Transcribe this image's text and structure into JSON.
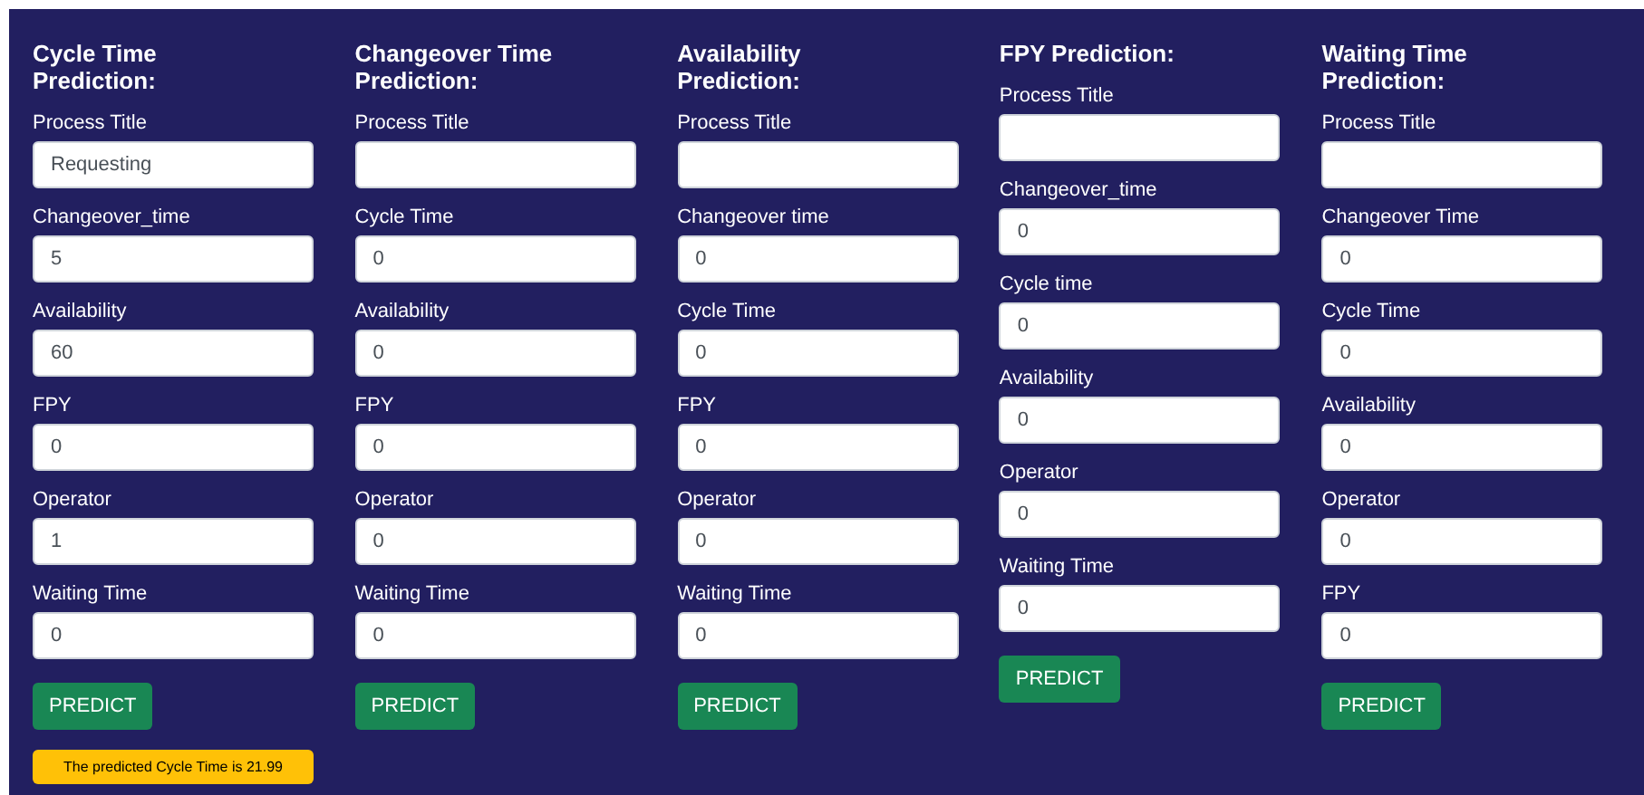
{
  "forms": [
    {
      "title": "Cycle Time Prediction:",
      "fields": [
        {
          "label": "Process Title",
          "value": "Requesting"
        },
        {
          "label": "Changeover_time",
          "value": "5"
        },
        {
          "label": "Availability",
          "value": "60"
        },
        {
          "label": "FPY",
          "value": "0"
        },
        {
          "label": "Operator",
          "value": "1"
        },
        {
          "label": "Waiting Time",
          "value": "0"
        }
      ],
      "button": "PREDICT",
      "result": "The predicted Cycle Time is 21.99"
    },
    {
      "title": "Changeover Time Prediction:",
      "fields": [
        {
          "label": "Process Title"
        },
        {
          "label": "Cycle Time",
          "value": "0"
        },
        {
          "label": "Availability",
          "value": "0"
        },
        {
          "label": "FPY",
          "value": "0"
        },
        {
          "label": "Operator",
          "value": "0"
        },
        {
          "label": "Waiting Time",
          "value": "0"
        }
      ],
      "button": "PREDICT"
    },
    {
      "title": "Availability Prediction:",
      "fields": [
        {
          "label": "Process Title"
        },
        {
          "label": "Changeover time",
          "value": "0"
        },
        {
          "label": "Cycle Time",
          "value": "0"
        },
        {
          "label": "FPY",
          "value": "0"
        },
        {
          "label": "Operator",
          "value": "0"
        },
        {
          "label": "Waiting Time",
          "value": "0"
        }
      ],
      "button": "PREDICT"
    },
    {
      "title": "FPY Prediction:",
      "fields": [
        {
          "label": "Process Title"
        },
        {
          "label": "Changeover_time",
          "value": "0"
        },
        {
          "label": "Cycle time",
          "value": "0"
        },
        {
          "label": "Availability",
          "value": "0"
        },
        {
          "label": "Operator",
          "value": "0"
        },
        {
          "label": "Waiting Time",
          "value": "0"
        }
      ],
      "button": "PREDICT"
    },
    {
      "title": "Waiting Time Prediction:",
      "fields": [
        {
          "label": "Process Title"
        },
        {
          "label": "Changeover Time",
          "value": "0"
        },
        {
          "label": "Cycle Time",
          "value": "0"
        },
        {
          "label": "Availability",
          "value": "0"
        },
        {
          "label": "Operator",
          "value": "0"
        },
        {
          "label": "FPY",
          "value": "0"
        }
      ],
      "button": "PREDICT"
    }
  ]
}
